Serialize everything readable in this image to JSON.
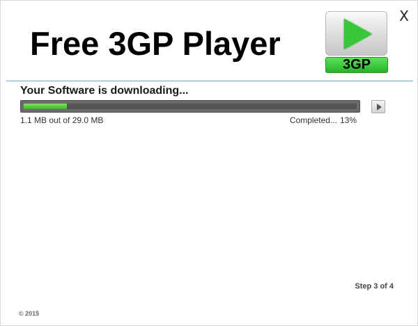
{
  "header": {
    "app_title": "Free 3GP Player",
    "logo_label": "3GP",
    "close_label": "X"
  },
  "download": {
    "heading": "Your Software is downloading...",
    "size_text": "1.1 MB out of 29.0 MB",
    "completed_label": "Completed...",
    "percent_text": "13%",
    "progress_fraction": 0.13
  },
  "footer": {
    "step_text": "Step 3 of 4",
    "copyright": "© 2015"
  },
  "colors": {
    "accent_divider": "#6aaedb",
    "progress_fill": "#4cc334",
    "progress_track": "#5a5a5a",
    "logo_green": "#35c735"
  },
  "icons": {
    "logo_play": "play-triangle-icon",
    "progress_play": "play-icon"
  }
}
